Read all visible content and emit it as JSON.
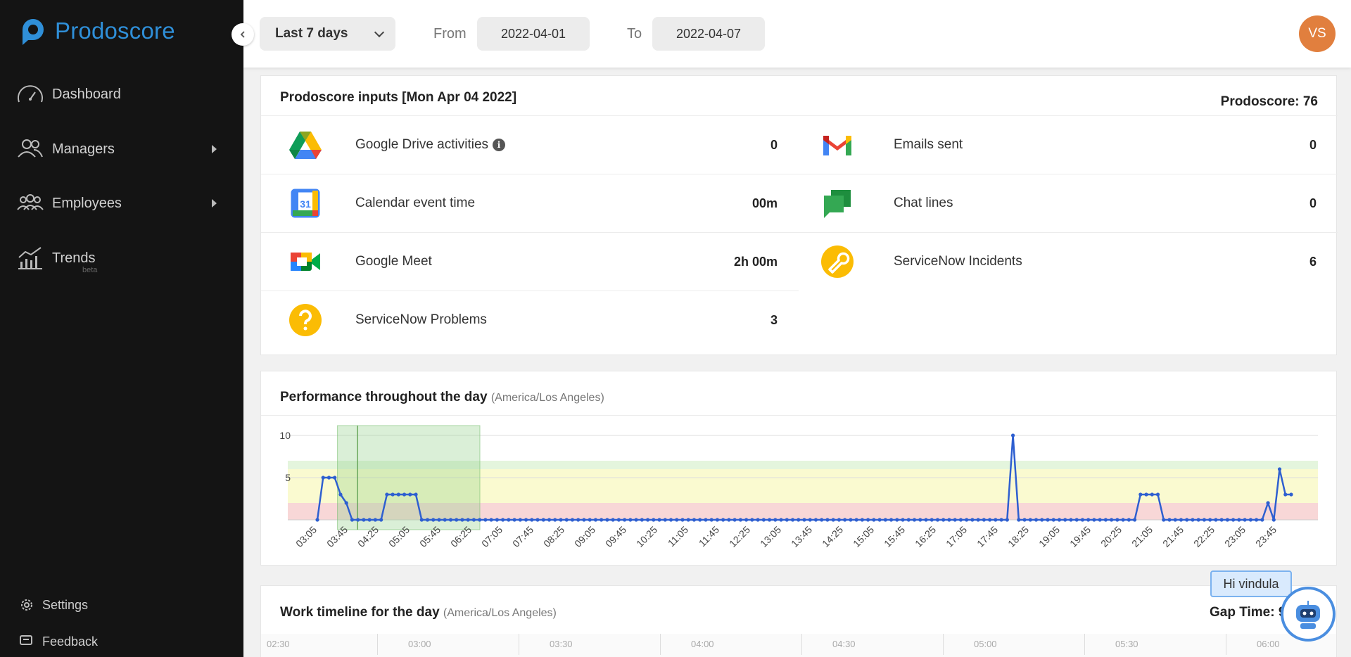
{
  "app": {
    "name": "Prodoscore"
  },
  "sidebar": {
    "items": [
      {
        "label": "Dashboard",
        "icon": "speedometer-icon"
      },
      {
        "label": "Managers",
        "icon": "users-icon"
      },
      {
        "label": "Employees",
        "icon": "group-icon"
      },
      {
        "label": "Trends",
        "icon": "trend-chart-icon",
        "badge": "beta"
      }
    ],
    "bottom": [
      {
        "label": "Settings",
        "icon": "gear-icon"
      },
      {
        "label": "Feedback",
        "icon": "feedback-icon"
      }
    ]
  },
  "topbar": {
    "range": "Last 7 days",
    "from_label": "From",
    "from_value": "2022-04-01",
    "to_label": "To",
    "to_value": "2022-04-07",
    "avatar_initials": "VS"
  },
  "inputs": {
    "title": "Prodoscore inputs [Mon Apr 04 2022]",
    "score": "Prodoscore: 76",
    "left": [
      {
        "label": "Google Drive activities",
        "value": "0",
        "icon": "google-drive-icon",
        "info": true
      },
      {
        "label": "Calendar event time",
        "value": "00m",
        "icon": "google-calendar-icon"
      },
      {
        "label": "Google Meet",
        "value": "2h 00m",
        "icon": "google-meet-icon"
      },
      {
        "label": "ServiceNow Problems",
        "value": "3",
        "icon": "question-icon"
      }
    ],
    "right": [
      {
        "label": "Emails sent",
        "value": "0",
        "icon": "gmail-icon"
      },
      {
        "label": "Chat lines",
        "value": "0",
        "icon": "google-chat-icon"
      },
      {
        "label": "ServiceNow Incidents",
        "value": "6",
        "icon": "wrench-icon"
      }
    ],
    "calendar_day": "31",
    "info_glyph": "i"
  },
  "performance": {
    "title": "Performance throughout the day",
    "timezone": "(America/Los Angeles)"
  },
  "chart_data": {
    "type": "line",
    "title": "Performance throughout the day",
    "yticks": [
      5,
      10
    ],
    "ylim": [
      0,
      10
    ],
    "xlabels": [
      "03:05",
      "03:45",
      "04:25",
      "05:05",
      "05:45",
      "06:25",
      "07:05",
      "07:45",
      "08:25",
      "09:05",
      "09:45",
      "10:25",
      "11:05",
      "11:45",
      "12:25",
      "13:05",
      "13:45",
      "14:25",
      "15:05",
      "15:45",
      "16:25",
      "17:05",
      "17:45",
      "18:25",
      "19:05",
      "19:45",
      "20:25",
      "21:05",
      "21:45",
      "22:25",
      "23:05",
      "23:45"
    ],
    "bands": [
      {
        "from": 0,
        "to": 2,
        "color": "#f8d7d7"
      },
      {
        "from": 2,
        "to": 6,
        "color": "#fafad0"
      },
      {
        "from": 6,
        "to": 7,
        "color": "#e4f5dd"
      }
    ],
    "highlight": {
      "from_index": 0.65,
      "to_index": 5.25,
      "marker_index": 1.3
    },
    "series": [
      {
        "color": "#2e5fd0",
        "values": [
          0,
          5,
          5,
          5,
          3,
          2,
          0,
          0,
          0,
          0,
          0,
          0,
          3,
          3,
          3,
          3,
          3,
          3,
          0,
          0,
          0,
          0,
          0,
          0,
          0,
          0,
          0,
          0,
          0,
          0,
          0,
          0,
          0,
          0,
          0,
          0,
          0,
          0,
          0,
          0,
          0,
          0,
          0,
          0,
          0,
          0,
          0,
          0,
          0,
          0,
          0,
          0,
          0,
          0,
          0,
          0,
          0,
          0,
          0,
          0,
          0,
          0,
          0,
          0,
          0,
          0,
          0,
          0,
          0,
          0,
          0,
          0,
          0,
          0,
          0,
          0,
          0,
          0,
          0,
          0,
          0,
          0,
          0,
          0,
          0,
          0,
          0,
          0,
          0,
          0,
          0,
          0,
          0,
          0,
          0,
          0,
          0,
          0,
          0,
          0,
          0,
          0,
          0,
          0,
          0,
          0,
          0,
          0,
          0,
          0,
          0,
          0,
          0,
          0,
          0,
          0,
          0,
          0,
          0,
          0,
          10,
          0,
          0,
          0,
          0,
          0,
          0,
          0,
          0,
          0,
          0,
          0,
          0,
          0,
          0,
          0,
          0,
          0,
          0,
          0,
          0,
          0,
          3,
          3,
          3,
          3,
          0,
          0,
          0,
          0,
          0,
          0,
          0,
          0,
          0,
          0,
          0,
          0,
          0,
          0,
          0,
          0,
          0,
          0,
          2,
          0,
          6,
          3,
          3
        ]
      }
    ]
  },
  "timeline": {
    "title": "Work timeline for the day",
    "timezone": "(America/Los Angeles)",
    "gap_time": "Gap Time: 9h",
    "ticks": [
      "02:30",
      "03:00",
      "03:30",
      "04:00",
      "04:30",
      "05:00",
      "05:30",
      "06:00"
    ]
  },
  "bot": {
    "greeting": "Hi vindula"
  },
  "colors": {
    "brand": "#2f8fd8",
    "avatar": "#e17f3e",
    "series": "#2e5fd0"
  }
}
